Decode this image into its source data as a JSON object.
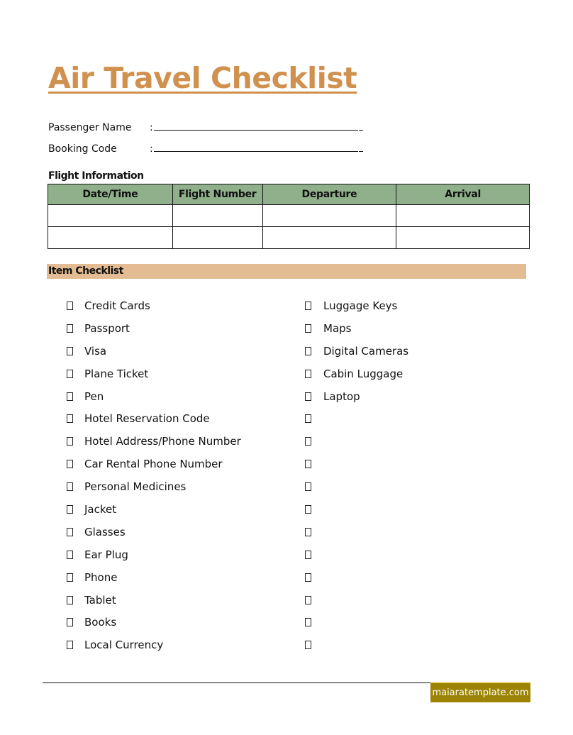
{
  "document": {
    "title": "Air Travel Checklist",
    "fields": [
      {
        "label": "Passenger Name",
        "separator": ":",
        "value": ""
      },
      {
        "label": "Booking Code",
        "separator": ":",
        "value": ""
      }
    ],
    "flight_section_title": "Flight Information",
    "flight_table": {
      "headers": [
        "Date/Time",
        "Flight Number",
        "Departure",
        "Arrival"
      ],
      "rows": [
        [
          "",
          "",
          "",
          ""
        ],
        [
          "",
          "",
          "",
          ""
        ]
      ]
    },
    "checklist_title": "Item Checklist",
    "checklist_left": [
      "Credit Cards",
      "Passport",
      "Visa",
      "Plane Ticket",
      "Pen",
      "Hotel Reservation Code",
      "Hotel Address/Phone Number",
      "Car Rental Phone Number",
      "Personal Medicines",
      "Jacket",
      "Glasses",
      "Ear Plug",
      "Phone",
      "Tablet",
      "Books",
      "Local Currency"
    ],
    "checklist_right": [
      "Luggage Keys",
      "Maps",
      "Digital Cameras",
      "Cabin Luggage",
      "Laptop",
      "",
      "",
      "",
      "",
      "",
      "",
      "",
      "",
      "",
      "",
      ""
    ],
    "footer_badge": "maiaratemplate.com"
  },
  "colors": {
    "title": "#d0914f",
    "table_header": "#8fb08b",
    "checklist_bar": "#e3bc93",
    "footer_badge": "#9c8402"
  }
}
